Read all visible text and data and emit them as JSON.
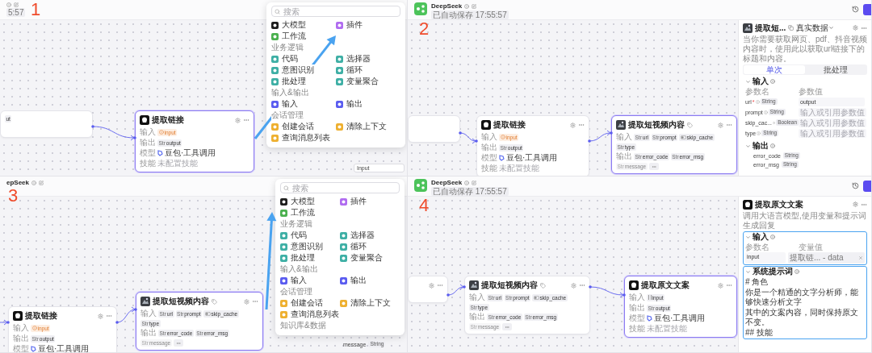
{
  "panels": [
    {
      "number": "1",
      "header": {
        "kind": "cropped",
        "status": "5:57"
      },
      "nodes": [
        {
          "kind": "fragment",
          "selected": false,
          "rows": [
            {
              "kind": "chips",
              "chips": [
                {
                  "kind": "string",
                  "name": "ut"
                }
              ]
            }
          ]
        },
        {
          "kind": "llm",
          "selected": true,
          "title": "提取链接",
          "rows": [
            {
              "kind": "chips",
              "label": "输入",
              "chips": [
                {
                  "kind": "warning",
                  "name": "input"
                }
              ]
            },
            {
              "kind": "chips",
              "label": "输出",
              "chips": [
                {
                  "kind": "string",
                  "prefix": "Str",
                  "name": "output"
                }
              ]
            },
            {
              "kind": "model",
              "label": "模型",
              "value": "豆包·工具调用"
            },
            {
              "kind": "note",
              "label": "技能",
              "value": "未配置技能"
            }
          ]
        }
      ],
      "menu": {
        "placeholder": "搜索",
        "entries": [
          {
            "kind": "item",
            "label": "大模型",
            "color": "#1e1e1e"
          },
          {
            "kind": "item",
            "label": "插件",
            "color": "#b06cf0"
          },
          {
            "kind": "item",
            "label": "工作流",
            "color": "#4bb04f"
          },
          {
            "kind": "section",
            "label": "业务逻辑"
          },
          {
            "kind": "item",
            "label": "代码",
            "color": "#3eafa5"
          },
          {
            "kind": "item",
            "label": "选择器",
            "color": "#3eafa5"
          },
          {
            "kind": "item",
            "label": "意图识别",
            "color": "#3eafa5"
          },
          {
            "kind": "item",
            "label": "循环",
            "color": "#3eafa5"
          },
          {
            "kind": "item",
            "label": "批处理",
            "color": "#3eafa5"
          },
          {
            "kind": "item",
            "label": "变量聚合",
            "color": "#3eafa5"
          },
          {
            "kind": "section",
            "label": "输入&输出"
          },
          {
            "kind": "item",
            "label": "输入",
            "color": "#5a5cf0"
          },
          {
            "kind": "item",
            "label": "输出",
            "color": "#5a5cf0"
          },
          {
            "kind": "section",
            "label": "会话管理"
          },
          {
            "kind": "item",
            "label": "创建会话",
            "color": "#eeb030"
          },
          {
            "kind": "item",
            "label": "清除上下文",
            "color": "#eeb030"
          },
          {
            "kind": "item",
            "label": "查询消息列表",
            "color": "#eeb030"
          }
        ]
      },
      "annotation_arrow": true,
      "fragment": {
        "kind": "field",
        "text": "Input"
      }
    },
    {
      "number": "2",
      "header": {
        "kind": "full",
        "title": "DeepSeek",
        "status": "已自动保存 17:55:57"
      },
      "nodes": [
        {
          "kind": "fragment",
          "selected": false
        },
        {
          "kind": "llm",
          "selected": false,
          "title": "提取链接",
          "rows": [
            {
              "kind": "chips",
              "label": "输入",
              "chips": [
                {
                  "kind": "warning",
                  "name": "input"
                }
              ]
            },
            {
              "kind": "chips",
              "label": "输出",
              "chips": [
                {
                  "kind": "string",
                  "prefix": "Str",
                  "name": "output"
                }
              ]
            },
            {
              "kind": "model",
              "label": "模型",
              "value": "豆包·工具调用"
            },
            {
              "kind": "note",
              "label": "技能",
              "value": "未配置技能"
            }
          ]
        },
        {
          "kind": "plugin",
          "selected": true,
          "title": "提取短视频内容",
          "rows": [
            {
              "kind": "chips",
              "label": "输入",
              "chips": [
                {
                  "kind": "string",
                  "prefix": "Str",
                  "name": "url"
                },
                {
                  "kind": "string",
                  "prefix": "Str",
                  "name": "prompt"
                },
                {
                  "kind": "boolean",
                  "name": "skip_cache"
                },
                {
                  "kind": "string",
                  "prefix": "Str",
                  "name": "type"
                }
              ]
            },
            {
              "kind": "chips",
              "label": "输出",
              "more": true,
              "chips": [
                {
                  "kind": "string",
                  "prefix": "Str",
                  "name": "error_code",
                  "faded": false
                },
                {
                  "kind": "string",
                  "prefix": "Str",
                  "name": "error_msg",
                  "faded": false
                },
                {
                  "kind": "string",
                  "prefix": "Str",
                  "name": "message",
                  "faded": true
                }
              ]
            }
          ]
        }
      ],
      "side": {
        "kind": "plugin",
        "title": "提取短...",
        "source": "真实数据",
        "description": "当你需要获取网页、pdf、抖音视频内容时，使用此以获取url链接下的标题和内容。",
        "tabs": [
          {
            "label": "单次",
            "selected": true
          },
          {
            "label": "批处理",
            "selected": false
          }
        ],
        "inputs": {
          "title": "输入",
          "expanded": true,
          "columns": [
            "参数名",
            "参数值"
          ],
          "params": [
            {
              "name": "url",
              "marker": "*",
              "type": "String",
              "value": "output"
            },
            {
              "name": "prompt",
              "type": "String",
              "placeholder": "输入或引用参数值"
            },
            {
              "name": "skip_cac...",
              "type": "Boolean",
              "placeholder": "输入或引用参数值"
            },
            {
              "name": "type",
              "type": "String",
              "placeholder": "输入或引用参数值"
            }
          ]
        },
        "outputs": {
          "title": "输出",
          "expanded": true,
          "params": [
            {
              "name": "error_code",
              "type": "String"
            },
            {
              "name": "error_msg",
              "type": "String"
            }
          ]
        }
      }
    },
    {
      "number": "3",
      "header": {
        "kind": "cropped",
        "title": "epSeek"
      },
      "nodes": [
        {
          "kind": "llm",
          "selected": false,
          "title": "提取链接",
          "rows": [
            {
              "kind": "chips",
              "label": "输入",
              "chips": [
                {
                  "kind": "warning",
                  "name": "input"
                }
              ]
            },
            {
              "kind": "chips",
              "label": "输出",
              "chips": [
                {
                  "kind": "string",
                  "prefix": "Str",
                  "name": "output"
                }
              ]
            },
            {
              "kind": "model",
              "label": "模型",
              "value": "豆包·工具调用"
            }
          ]
        },
        {
          "kind": "plugin",
          "selected": true,
          "title": "提取短视频内容",
          "rows": [
            {
              "kind": "chips",
              "label": "输入",
              "chips": [
                {
                  "kind": "string",
                  "prefix": "Str",
                  "name": "url"
                },
                {
                  "kind": "string",
                  "prefix": "Str",
                  "name": "prompt"
                },
                {
                  "kind": "boolean",
                  "name": "skip_cache"
                },
                {
                  "kind": "string",
                  "prefix": "Str",
                  "name": "type"
                }
              ]
            },
            {
              "kind": "chips",
              "label": "输出",
              "more": true,
              "chips": [
                {
                  "kind": "string",
                  "prefix": "Str",
                  "name": "error_code",
                  "faded": false
                },
                {
                  "kind": "string",
                  "prefix": "Str",
                  "name": "error_msg",
                  "faded": false
                },
                {
                  "kind": "string",
                  "prefix": "Str",
                  "name": "message",
                  "faded": true
                }
              ]
            }
          ]
        }
      ],
      "menu": {
        "placeholder": "搜索",
        "entries": [
          {
            "kind": "item",
            "label": "大模型",
            "color": "#1e1e1e"
          },
          {
            "kind": "item",
            "label": "插件",
            "color": "#b06cf0"
          },
          {
            "kind": "item",
            "label": "工作流",
            "color": "#4bb04f"
          },
          {
            "kind": "section",
            "label": "业务逻辑"
          },
          {
            "kind": "item",
            "label": "代码",
            "color": "#3eafa5"
          },
          {
            "kind": "item",
            "label": "选择器",
            "color": "#3eafa5"
          },
          {
            "kind": "item",
            "label": "意图识别",
            "color": "#3eafa5"
          },
          {
            "kind": "item",
            "label": "循环",
            "color": "#3eafa5"
          },
          {
            "kind": "item",
            "label": "批处理",
            "color": "#3eafa5"
          },
          {
            "kind": "item",
            "label": "变量聚合",
            "color": "#3eafa5"
          },
          {
            "kind": "section",
            "label": "输入&输出"
          },
          {
            "kind": "item",
            "label": "输入",
            "color": "#5a5cf0"
          },
          {
            "kind": "item",
            "label": "输出",
            "color": "#5a5cf0"
          },
          {
            "kind": "section",
            "label": "会话管理"
          },
          {
            "kind": "item",
            "label": "创建会话",
            "color": "#eeb030"
          },
          {
            "kind": "item",
            "label": "清除上下文",
            "color": "#eeb030"
          },
          {
            "kind": "item",
            "label": "查询消息列表",
            "color": "#eeb030"
          },
          {
            "kind": "section",
            "label": "知识库&数据"
          }
        ]
      },
      "annotation_arrow": true,
      "fragment": {
        "kind": "output",
        "text": "message",
        "type": "String"
      }
    },
    {
      "number": "4",
      "header": {
        "kind": "full",
        "title": "DeepSeek",
        "status": "已自动保存 17:55:57"
      },
      "nodes": [
        {
          "kind": "stub",
          "selected": false
        },
        {
          "kind": "plugin",
          "selected": false,
          "title": "提取短视频内容",
          "rows": [
            {
              "kind": "chips",
              "label": "输入",
              "chips": [
                {
                  "kind": "string",
                  "prefix": "Str",
                  "name": "url"
                },
                {
                  "kind": "string",
                  "prefix": "Str",
                  "name": "prompt"
                },
                {
                  "kind": "boolean",
                  "name": "skip_cache"
                },
                {
                  "kind": "string",
                  "prefix": "Str",
                  "name": "type"
                }
              ]
            },
            {
              "kind": "chips",
              "label": "输出",
              "more": true,
              "chips": [
                {
                  "kind": "string",
                  "prefix": "Str",
                  "name": "error_code",
                  "faded": false
                },
                {
                  "kind": "string",
                  "prefix": "Str",
                  "name": "error_msg",
                  "faded": false
                },
                {
                  "kind": "string",
                  "prefix": "Str",
                  "name": "message",
                  "faded": true
                }
              ]
            }
          ]
        },
        {
          "kind": "llm",
          "selected": true,
          "title": "提取原文文案",
          "rows": [
            {
              "kind": "chips",
              "label": "输入",
              "chips": [
                {
                  "kind": "reference",
                  "name": "input"
                }
              ]
            },
            {
              "kind": "chips",
              "label": "输出",
              "chips": [
                {
                  "kind": "string",
                  "prefix": "Str",
                  "name": "output"
                }
              ]
            },
            {
              "kind": "model",
              "label": "模型",
              "value": "豆包·工具调用"
            },
            {
              "kind": "note",
              "label": "技能",
              "value": "未配置技能"
            }
          ]
        }
      ],
      "side": {
        "kind": "llm",
        "title": "提取原文文案",
        "description": "调用大语言模型,使用变量和提示词生成回复",
        "inputs": {
          "title": "输入",
          "expanded": true,
          "highlighted": true,
          "columns": [
            "参数名",
            "变量值"
          ],
          "fields": [
            {
              "name": "input",
              "ref": "提取链... - data"
            }
          ]
        },
        "prompt": {
          "title": "系统提示词",
          "expanded": true,
          "highlighted": true,
          "lines": [
            "# 角色",
            "你是一个精通的文字分析师，能够快速分析文字",
            "其中的文案内容，同时保持原文不变。",
            "## 技能"
          ]
        }
      }
    }
  ]
}
